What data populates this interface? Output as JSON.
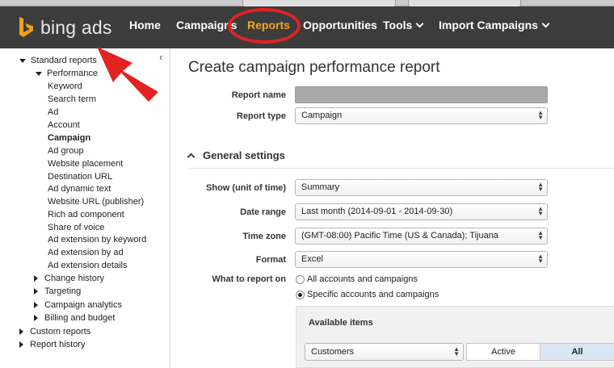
{
  "nav": {
    "brand": "bing ads",
    "items": [
      {
        "label": "Home",
        "dropdown": false,
        "active": false
      },
      {
        "label": "Campaigns",
        "dropdown": false,
        "active": false
      },
      {
        "label": "Reports",
        "dropdown": false,
        "active": true
      },
      {
        "label": "Opportunities",
        "dropdown": false,
        "active": false
      },
      {
        "label": "Tools",
        "dropdown": true,
        "active": false
      },
      {
        "label": "Import Campaigns",
        "dropdown": true,
        "active": false
      }
    ]
  },
  "sidebar": {
    "collapse_glyph": "‹",
    "tree": [
      {
        "label": "Standard reports",
        "state": "expanded",
        "bold": false
      },
      {
        "label": "Performance",
        "state": "expanded",
        "bold": false
      },
      {
        "label": "Keyword",
        "state": "leaf",
        "bold": false
      },
      {
        "label": "Search term",
        "state": "leaf",
        "bold": false
      },
      {
        "label": "Ad",
        "state": "leaf",
        "bold": false
      },
      {
        "label": "Account",
        "state": "leaf",
        "bold": false
      },
      {
        "label": "Campaign",
        "state": "leaf",
        "bold": true
      },
      {
        "label": "Ad group",
        "state": "leaf",
        "bold": false
      },
      {
        "label": "Website placement",
        "state": "leaf",
        "bold": false
      },
      {
        "label": "Destination URL",
        "state": "leaf",
        "bold": false
      },
      {
        "label": "Ad dynamic text",
        "state": "leaf",
        "bold": false
      },
      {
        "label": "Website URL (publisher)",
        "state": "leaf",
        "bold": false
      },
      {
        "label": "Rich ad component",
        "state": "leaf",
        "bold": false
      },
      {
        "label": "Share of voice",
        "state": "leaf",
        "bold": false
      },
      {
        "label": "Ad extension by keyword",
        "state": "leaf",
        "bold": false
      },
      {
        "label": "Ad extension by ad",
        "state": "leaf",
        "bold": false
      },
      {
        "label": "Ad extension details",
        "state": "leaf",
        "bold": false
      },
      {
        "label": "Change history",
        "state": "collapsed",
        "bold": false
      },
      {
        "label": "Targeting",
        "state": "collapsed",
        "bold": false
      },
      {
        "label": "Campaign analytics",
        "state": "collapsed",
        "bold": false
      },
      {
        "label": "Billing and budget",
        "state": "collapsed",
        "bold": false
      },
      {
        "label": "Custom reports",
        "state": "collapsed",
        "bold": false
      },
      {
        "label": "Report history",
        "state": "collapsed",
        "bold": false
      }
    ]
  },
  "main": {
    "title": "Create campaign performance report",
    "report_name": {
      "label": "Report name",
      "value": ""
    },
    "report_type": {
      "label": "Report type",
      "value": "Campaign"
    },
    "general_settings": "General settings",
    "show_unit": {
      "label": "Show (unit of time)",
      "value": "Summary"
    },
    "date_range": {
      "label": "Date range",
      "value": "Last month (2014-09-01 - 2014-09-30)"
    },
    "time_zone": {
      "label": "Time zone",
      "value": "(GMT-08:00) Pacific Time (US & Canada); Tijuana"
    },
    "format": {
      "label": "Format",
      "value": "Excel"
    },
    "what_to_report": {
      "label": "What to report on",
      "options": [
        "All accounts and campaigns",
        "Specific accounts and campaigns"
      ],
      "selected": 1
    },
    "available": {
      "title": "Available items",
      "filter": "Customers",
      "active_label": "Active",
      "all_label": "All"
    }
  },
  "colors": {
    "nav_bg": "#3c3c3c",
    "nav_active": "#f5a623",
    "brand_orange": "#f0a01e",
    "annotation_red": "#e32222"
  },
  "annotations": {
    "arrow": "red arrow pointing to Search term",
    "circle": "red ellipse around Reports"
  }
}
